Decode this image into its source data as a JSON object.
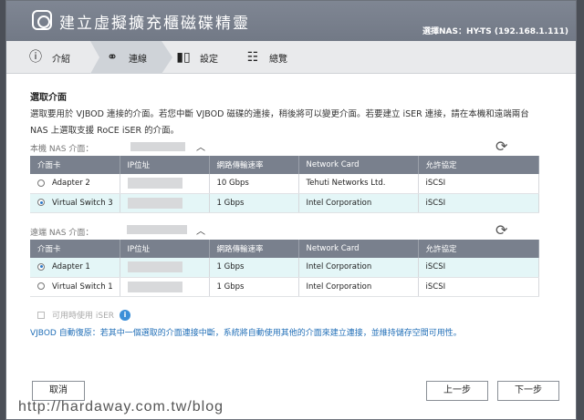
{
  "window": {
    "title": "建立虛擬擴充櫃磁碟精靈",
    "nas_label": "選擇NAS：HY-TS (192.168.1.111)"
  },
  "steps": [
    {
      "label": "介紹",
      "icon": "info-icon"
    },
    {
      "label": "連線",
      "icon": "link-icon"
    },
    {
      "label": "設定",
      "icon": "settings-icon"
    },
    {
      "label": "總覽",
      "icon": "clipboard-icon"
    }
  ],
  "main": {
    "section_title": "選取介面",
    "description": "選取要用於 VJBOD 連接的介面。若您中斷 VJBOD 磁碟的連接，稍後將可以變更介面。若要建立 iSER 連接，請在本機和遠端兩台 NAS 上選取支援 RoCE iSER 的介面。",
    "local_label": "本機 NAS 介面：",
    "remote_label": "遠端 NAS 介面："
  },
  "table_headers": [
    "介面卡",
    "IP位址",
    "網路傳輸速率",
    "Network Card",
    "允許協定"
  ],
  "local_rows": [
    {
      "adapter": "Adapter 2",
      "speed": "10 Gbps",
      "card": "Tehuti Networks Ltd.",
      "protocol": "iSCSI",
      "selected": false
    },
    {
      "adapter": "Virtual Switch 3",
      "speed": "1 Gbps",
      "card": "Intel Corporation",
      "protocol": "iSCSI",
      "selected": true
    }
  ],
  "remote_rows": [
    {
      "adapter": "Adapter 1",
      "speed": "1 Gbps",
      "card": "Intel Corporation",
      "protocol": "iSCSI",
      "selected": true
    },
    {
      "adapter": "Virtual Switch 1",
      "speed": "1 Gbps",
      "card": "Intel Corporation",
      "protocol": "iSCSI",
      "selected": false
    }
  ],
  "iser_label": "可用時使用 iSER",
  "note": "VJBOD 自動復原：若其中一個選取的介面連接中斷，系統將自動使用其他的介面來建立連接，並維持儲存空間可用性。",
  "buttons": {
    "cancel": "取消",
    "back": "上一步",
    "next": "下一步"
  },
  "watermark": "http://hardaway.com.tw/blog"
}
